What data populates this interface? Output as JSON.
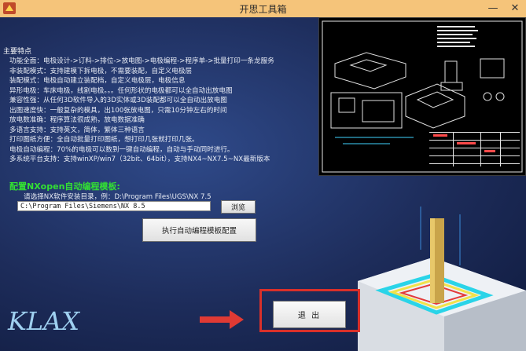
{
  "window": {
    "title": "开思工具箱",
    "minimize_glyph": "—",
    "close_glyph": "✕"
  },
  "features": {
    "heading": "主要特点",
    "items": [
      "功能全面：电极设计->订料->排位->放电图->电极编程->程序单->批量打印一条龙服务",
      "非装配模式：支持建模下拆电极，不需要装配，自定义电极层",
      "装配模式：电极自动建立装配档，自定义电极层，电极信息",
      "异形电极：车床电极，线割电极。。。任何形状的电极都可以全自动出放电图",
      "兼容性强：从任何3D软件导入的3D实体或3D装配都可以全自动出放电图",
      "出图速度快：一般复杂的模具，出100张放电图，只需10分钟左右的时间",
      "放电数准确：程序算法很成熟，放电数据准确",
      "多语言支持：支持英文，简体，繁体三种语言",
      "打印图纸方便：全自动批量打印图纸，想打印几张就打印几张。",
      "电极自动编程：70%的电极可以数到一键自动编程，自动与手动同时进行。",
      "多系统平台支持：支持winXP/win7（32bit、64bit），支持NX4~NX7.5~NX最新版本"
    ]
  },
  "config": {
    "title": "配置NXopen自动编程模板:",
    "path_label": "请选择NX软件安装目录，例：D:\\Program Files\\UGS\\NX 7.5",
    "path_value": "C:\\Program Files\\Siemens\\NX 8.5",
    "browse_label": "浏览",
    "run_label": "执行自动编程模板配置"
  },
  "exit_label": "退 出",
  "brand": {
    "text": "KLAX"
  },
  "icons": {
    "app_logo": "app-logo-icon",
    "arrow": "arrow-right-icon"
  },
  "colors": {
    "titlebar": "#f5c47a",
    "background": "#1d2c55",
    "config_title": "#33e033",
    "highlight_frame": "#d9302a",
    "arrow": "#e03a34"
  }
}
